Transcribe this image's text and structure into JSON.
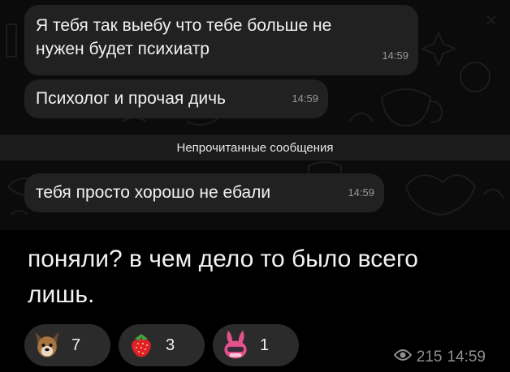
{
  "screenshot": {
    "messages": [
      {
        "lines": [
          "Я тебя так выебу что тебе больше не",
          "нужен будет психиатр"
        ],
        "time": "14:59"
      },
      {
        "text": "Психолог и прочая дичь",
        "time": "14:59"
      },
      {
        "text": "тебя просто хорошо не ебали",
        "time": "14:59"
      }
    ],
    "unread_divider": "Непрочитанные сообщения"
  },
  "post": {
    "text": "поняли? в чем дело то было всего лишь.",
    "reactions": [
      {
        "icon": "dog-sticker-icon",
        "count": "7"
      },
      {
        "icon": "strawberry-icon",
        "count": "3"
      },
      {
        "icon": "pink-bunny-sticker-icon",
        "count": "1"
      }
    ],
    "views": "215",
    "time": "14:59"
  },
  "colors": {
    "background": "#000000",
    "bubble": "#212121",
    "reaction_pill": "#2b2b2b",
    "meta_text": "#8f8f8f"
  }
}
